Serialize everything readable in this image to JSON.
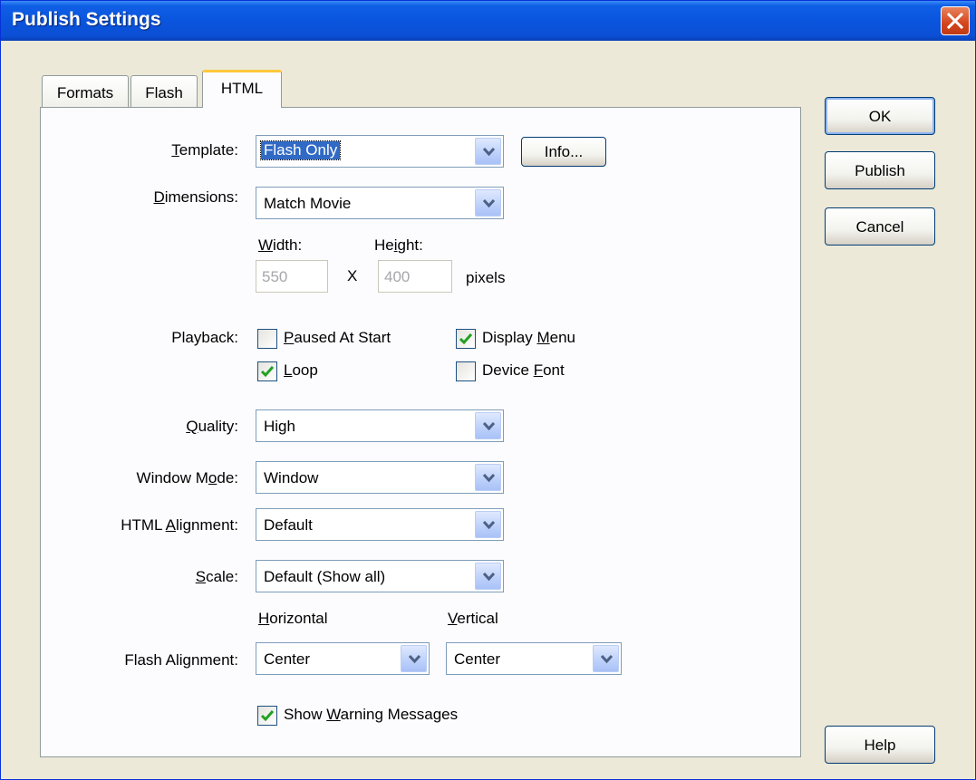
{
  "window": {
    "title": "Publish Settings"
  },
  "tabs": [
    {
      "label": "Formats",
      "active": false
    },
    {
      "label": "Flash",
      "active": false
    },
    {
      "label": "HTML",
      "active": true
    }
  ],
  "buttons": {
    "ok": "OK",
    "publish": "Publish",
    "cancel": "Cancel",
    "help": "Help",
    "info": "Info..."
  },
  "fields": {
    "template": {
      "label_pre": "",
      "label_u": "T",
      "label_post": "emplate:",
      "value": "Flash Only"
    },
    "dimensions": {
      "label_u": "D",
      "label_post": "imensions:",
      "value": "Match Movie"
    },
    "width": {
      "label_u": "W",
      "label_post": "idth:",
      "value": "550"
    },
    "height": {
      "label_pre": "He",
      "label_u": "i",
      "label_post": "ght:",
      "value": "400"
    },
    "times": "X",
    "units": "pixels",
    "playback_label": "Playback:",
    "quality": {
      "label_u": "Q",
      "label_post": "uality:",
      "value": "High"
    },
    "window_mode": {
      "label_pre": "Window M",
      "label_u": "o",
      "label_post": "de:",
      "value": "Window"
    },
    "html_alignment": {
      "label_pre": "HTML ",
      "label_u": "A",
      "label_post": "lignment:",
      "value": "Default"
    },
    "scale": {
      "label_u": "S",
      "label_post": "cale:",
      "value": "Default (Show all)"
    },
    "horizontal": {
      "label_u": "H",
      "label_post": "orizontal"
    },
    "vertical": {
      "label_u": "V",
      "label_post": "ertical"
    },
    "flash_alignment_label": "Flash Alignment:",
    "h_align_value": "Center",
    "v_align_value": "Center"
  },
  "checkboxes": {
    "paused": {
      "pre": "",
      "u": "P",
      "post": "aused At Start",
      "checked": false
    },
    "display_menu": {
      "pre": "Display ",
      "u": "M",
      "post": "enu",
      "checked": true
    },
    "loop": {
      "pre": "",
      "u": "L",
      "post": "oop",
      "checked": true
    },
    "device_font": {
      "pre": "Device ",
      "u": "F",
      "post": "ont",
      "checked": false
    },
    "show_warnings": {
      "pre": "Show ",
      "u": "W",
      "post": "arning Messages",
      "checked": true
    }
  },
  "colors": {
    "titlebar": "#0a55dd",
    "accent_tab": "#ffc83c",
    "selection": "#316ac5",
    "check": "#21a121"
  }
}
